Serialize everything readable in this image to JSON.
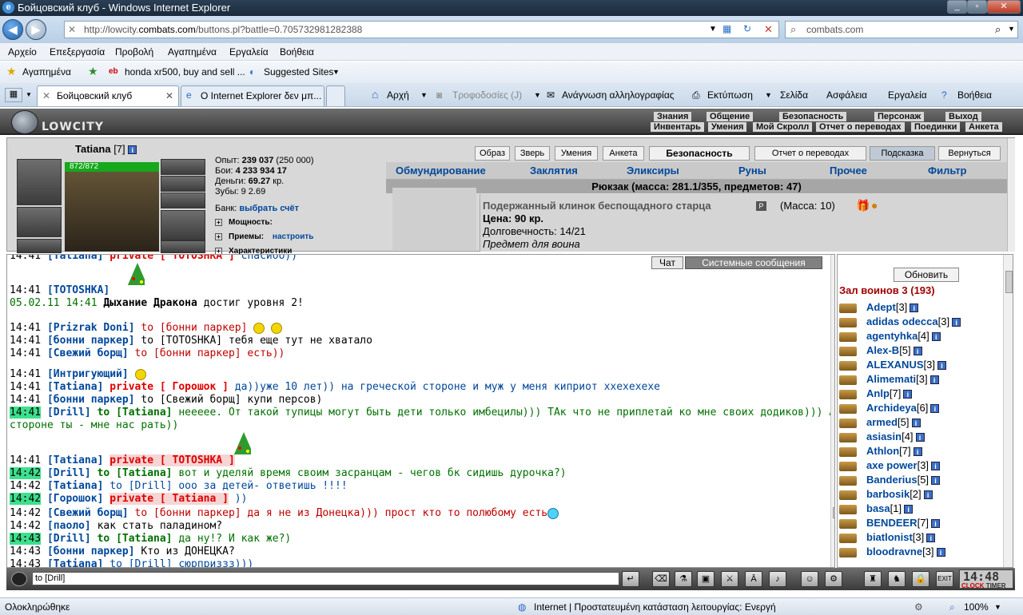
{
  "window": {
    "title": "Бойцовский клуб - Windows Internet Explorer"
  },
  "address": {
    "url_prefix": "http://lowcity.",
    "url_domain": "combats.com",
    "url_rest": "/buttons.pl?battle=0.705732981282388"
  },
  "search": {
    "value": "combats.com"
  },
  "menu": [
    "Αρχείο",
    "Επεξεργασία",
    "Προβολή",
    "Αγαπημένα",
    "Εργαλεία",
    "Βοήθεια"
  ],
  "favbar": {
    "favorites": "Αγαπημένα",
    "item1": "honda xr500, buy and sell ...",
    "item2": "Suggested Sites"
  },
  "tabs": [
    {
      "label": "Бойцовский клуб"
    },
    {
      "label": "Ο Internet Explorer δεν μπ..."
    }
  ],
  "commands": {
    "home": "Αρχή",
    "feeds": "Τροφοδοσίες (J)",
    "mail": "Ανάγνωση αλληλογραφίας",
    "print": "Εκτύπωση",
    "page": "Σελίδα",
    "safety": "Ασφάλεια",
    "tools": "Εργαλεία",
    "help": "Βοήθεια"
  },
  "game": {
    "logo": "LOWCITY",
    "nav_top": [
      "Знания",
      "Общение",
      "Безопасность",
      "Персонаж",
      "Выход"
    ],
    "nav_bottom": [
      "Инвентарь",
      "Умения",
      "Мой Скролл",
      "Отчет о переводах",
      "Поединки",
      "Анкета"
    ]
  },
  "character": {
    "name": "Tatiana",
    "level": "[7]",
    "hp": "872/872",
    "exp_label": "Опыт:",
    "exp_value": "239 037",
    "exp_next": "(250 000)",
    "fights_label": "Бои:",
    "fights_win": "4 233",
    "fights_loss": "934",
    "fights_draw": "17",
    "money_label": "Деньги:",
    "money_value": "69.27",
    "money_unit": "кр.",
    "teeth_label": "Зубы:",
    "teeth_value": "9",
    "teeth_value2": "2.69",
    "bank_label": "Банк:",
    "bank_link": "выбрать счёт",
    "sections": [
      "Мощность:",
      "Приемы:",
      "Характеристики"
    ],
    "configure": "настроить"
  },
  "topbuttons": [
    "Образ",
    "Зверь",
    "Умения",
    "Анкета",
    "Безопасность",
    "Отчет о переводах",
    "Подсказка",
    "Вернуться"
  ],
  "invtabs": [
    "Обмундирование",
    "Заклятия",
    "Эликсиры",
    "Руны",
    "Прочее",
    "Фильтр"
  ],
  "bag": "Рюкзак (масса: 281.1/355, предметов: 47)",
  "item": {
    "name": "Подержанный клинок беспощадного старца",
    "mass": "(Масса: 10)",
    "price": "Цена: 90 кр.",
    "durability": "Долговечность: 14/21",
    "for": "Предмет для воина"
  },
  "chat": {
    "tab_chat": "Чат",
    "tab_system": "Системные сообщения",
    "lines": [
      {
        "time": "14:41",
        "nick": "[Tatiana]",
        "pv": "private [ TOTOSHKA ]",
        "text": "спасибо))"
      },
      {
        "time": "14:41",
        "nick": "[TOTOSHKA]"
      },
      {
        "time": "05.02.11 14:41",
        "bold": "Дыхание Дракона",
        "text": " достиг уровня 2!"
      },
      {
        "time": "14:41",
        "nick": "[Prizrak Doni]",
        "to": "to [бонни паркер]"
      },
      {
        "time": "14:41",
        "nick": "[бонни паркер]",
        "text": "to [TOTOSHKA] тебя еще тут не хватало"
      },
      {
        "time": "14:41",
        "nick": "[Свежий борщ]",
        "text": "to [бонни паркер] есть))"
      },
      {
        "time": "14:41",
        "nick": "[Интригующий]"
      },
      {
        "time": "14:41",
        "nick": "[Tatiana]",
        "pv": "private [ Горошок ]",
        "text": "да))уже 10 лет)) на греческой стороне и муж у меня киприот ххехехехе"
      },
      {
        "time": "14:41",
        "nick": "[бонни паркер]",
        "text": "to [Свежий борщ] купи персов)"
      },
      {
        "time": "14:41",
        "nick": "[Drill]",
        "to": "to [Tatiana]",
        "text": "неееее. От такой тупицы могут быть дети только имбецилы))) ТАк что не приплетай ко мне своих додиков))) А на какой",
        "text2": "стороне ты - мне нас рать))"
      },
      {
        "time": "14:41",
        "nick": "[Tatiana]",
        "pv": "private [ TOTOSHKA ]"
      },
      {
        "time": "14:42",
        "nick": "[Drill]",
        "to": "to [Tatiana]",
        "text": "вот и уделяй время своим засранцам - чегов бк сидишь дурочка?)"
      },
      {
        "time": "14:42",
        "nick": "[Tatiana]",
        "text": "to [Drill] ооо за детей- ответишь !!!!"
      },
      {
        "time": "14:42",
        "nick": "[Горошок]",
        "pv": "private [ Tatiana ]",
        "text": "))"
      },
      {
        "time": "14:42",
        "nick": "[Свежий борщ]",
        "text": "to [бонни паркер] да я не из Донецка))) прост кто то полюбому есть"
      },
      {
        "time": "14:42",
        "nick": "[паоло]",
        "text": "как стать паладином?"
      },
      {
        "time": "14:43",
        "nick": "[Drill]",
        "to": "to [Tatiana]",
        "text": "да ну!? И как же?)"
      },
      {
        "time": "14:43",
        "nick": "[бонни паркер]",
        "text": "Кто из ДОНЕЦКА?"
      },
      {
        "time": "14:43",
        "nick": "[Tatiana]",
        "text": "to [Drill] сюрприззз)))"
      }
    ]
  },
  "room": {
    "refresh": "Обновить",
    "hall": "Зал воинов 3 (193)",
    "players": [
      {
        "name": "Adept",
        "lvl": "[3]"
      },
      {
        "name": "adidas odecca",
        "lvl": "[3]"
      },
      {
        "name": "agentyhka",
        "lvl": "[4]"
      },
      {
        "name": "Alex-B",
        "lvl": "[5]"
      },
      {
        "name": "ALEXANUS",
        "lvl": "[3]"
      },
      {
        "name": "Alimemati",
        "lvl": "[3]"
      },
      {
        "name": "Anlp",
        "lvl": "[7]"
      },
      {
        "name": "Archideya",
        "lvl": "[6]"
      },
      {
        "name": "armed",
        "lvl": "[5]"
      },
      {
        "name": "asiasin",
        "lvl": "[4]"
      },
      {
        "name": "Athlon",
        "lvl": "[7]"
      },
      {
        "name": "axe power",
        "lvl": "[3]"
      },
      {
        "name": "Banderius",
        "lvl": "[5]"
      },
      {
        "name": "barbosik",
        "lvl": "[2]"
      },
      {
        "name": "basa",
        "lvl": "[1]"
      },
      {
        "name": "BENDEER",
        "lvl": "[7]"
      },
      {
        "name": "biatlonist",
        "lvl": "[3]"
      },
      {
        "name": "bloodravne",
        "lvl": "[3]"
      }
    ]
  },
  "input": {
    "value": "to [Drill] "
  },
  "clock": {
    "time": "14:48",
    "label1": "CLOCK",
    "label2": "TIMER"
  },
  "status": {
    "left": "Ολοκληρώθηκε",
    "zone": "Internet | Προστατευμένη κατάσταση λειτουργίας: Ενεργή",
    "zoom": "100%"
  }
}
